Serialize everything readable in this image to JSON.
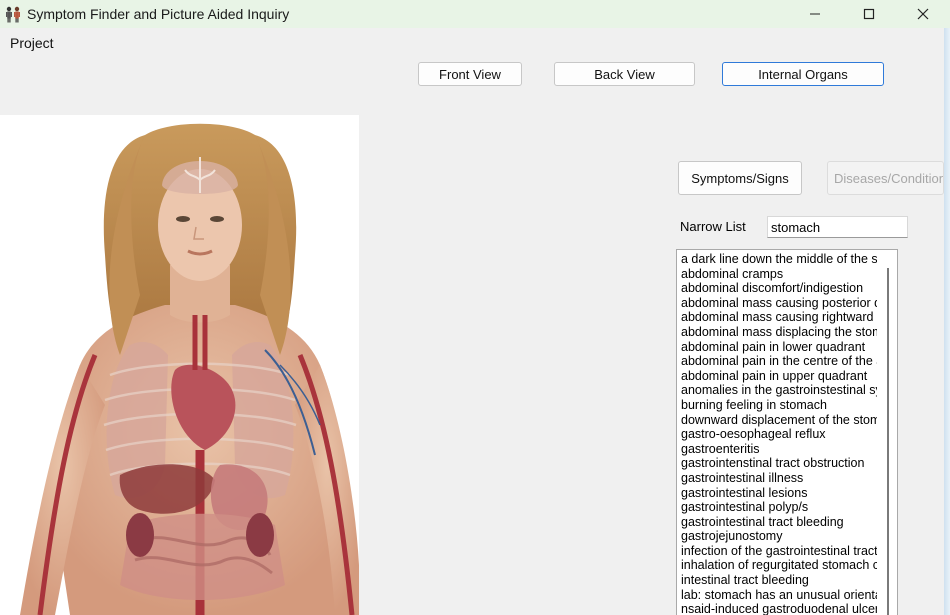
{
  "window": {
    "title": "Symptom Finder and Picture Aided Inquiry",
    "controls": {
      "minimize": "—",
      "maximize": "☐",
      "close": "✕"
    }
  },
  "menu": {
    "items": [
      "Project"
    ]
  },
  "view_buttons": [
    {
      "label": "Front View",
      "active": false
    },
    {
      "label": "Back View",
      "active": false
    },
    {
      "label": "Internal Organs",
      "active": true
    }
  ],
  "tabs": {
    "symptoms": {
      "label": "Symptoms/Signs",
      "enabled": true
    },
    "diseases": {
      "label": "Diseases/Conditions",
      "enabled": false
    }
  },
  "filter": {
    "label": "Narrow List",
    "value": "stomach"
  },
  "symptom_list": [
    "a dark line down the middle of the stomach",
    "abdominal cramps",
    "abdominal discomfort/indigestion",
    "abdominal mass causing posterior displacement",
    "abdominal mass causing rightward displacement",
    "abdominal mass displacing the stomach",
    "abdominal pain in lower quadrant",
    "abdominal pain in the centre of the abdomen",
    "abdominal pain in upper quadrant",
    "anomalies in the gastroinstestinal system",
    "burning feeling in stomach",
    "downward displacement of the stomach",
    "gastro-oesophageal reflux",
    "gastroenteritis",
    "gastrointenstinal tract obstruction",
    "gastrointestinal illness",
    "gastrointestinal lesions",
    "gastrointestinal polyp/s",
    "gastrointestinal tract bleeding",
    "gastrojejunostomy",
    "infection of the gastrointestinal tract",
    "inhalation of regurgitated stomach contents",
    "intestinal tract bleeding",
    "lab: stomach has an unusual orientation",
    "nsaid-induced gastroduodenal ulcers"
  ],
  "colors": {
    "titlebar": "#e8f4e6",
    "window_bg": "#f0f0f0",
    "active_border": "#2f7ad9",
    "disabled_text": "#a7a7a7"
  }
}
